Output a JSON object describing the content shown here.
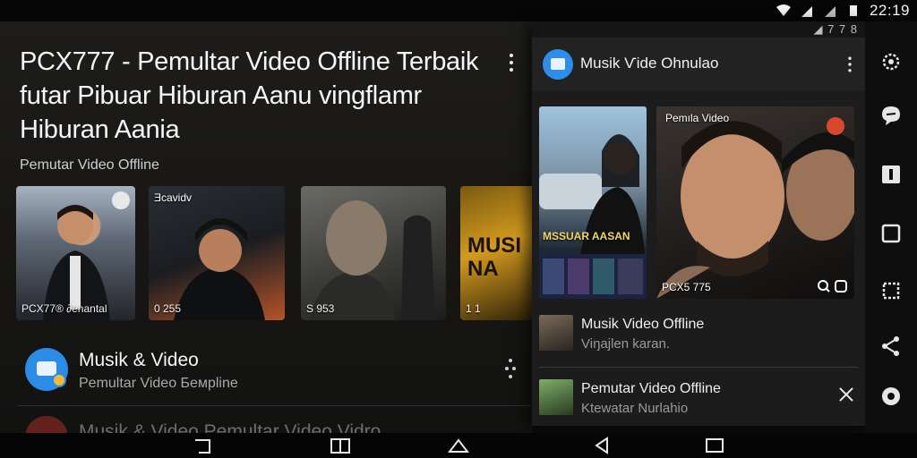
{
  "status": {
    "time": "22:19",
    "panel_mini": "◢ 7 7 8"
  },
  "main": {
    "title": "PCX777 - Pemultar Video Offline Terbaik futar Pibuar Hiburan Aanu vingflamr Hiburan Aania",
    "subtitle": "Pemutar Video Offline",
    "thumbs": [
      {
        "caption": "PCX77® ∂enantal",
        "tag": ""
      },
      {
        "caption": "0 255",
        "tag": "Ǝcavidv"
      },
      {
        "caption": "S 953",
        "tag": ""
      },
      {
        "caption": "1 1",
        "tag": "MUSI NA"
      }
    ],
    "list": [
      {
        "title": "Musik & Video",
        "subtitle": "Pemultar Video Бемpline"
      },
      {
        "title": "Musik & Video Pemultar Video Vidro"
      }
    ]
  },
  "panel": {
    "title": "Musik Ѵide Ohnulao",
    "thumb1_overlay": "MSSUAR AASAN",
    "thumb2_label": "Pemıla Video",
    "thumb2_caption": "PCX5 775",
    "items": [
      {
        "title": "Musik Video Offline",
        "subtitle": "Viŋajlen karan."
      },
      {
        "title": "Pemutar Video Offline",
        "subtitle": "Ktewatar Nurlahio"
      }
    ]
  },
  "rail": {
    "icons": [
      "settings-gear-icon",
      "chat-bubble-icon",
      "info-icon",
      "square-icon",
      "screenshot-icon",
      "share-icon",
      "record-icon"
    ]
  },
  "nav": {
    "icons": [
      "back-icon",
      "split-icon",
      "home-icon",
      "back-triangle-icon",
      "recents-icon"
    ]
  },
  "colors": {
    "accent_blue": "#2b8ce6",
    "panel_bg": "#1c1c1d",
    "background": "#0b0b0b"
  }
}
